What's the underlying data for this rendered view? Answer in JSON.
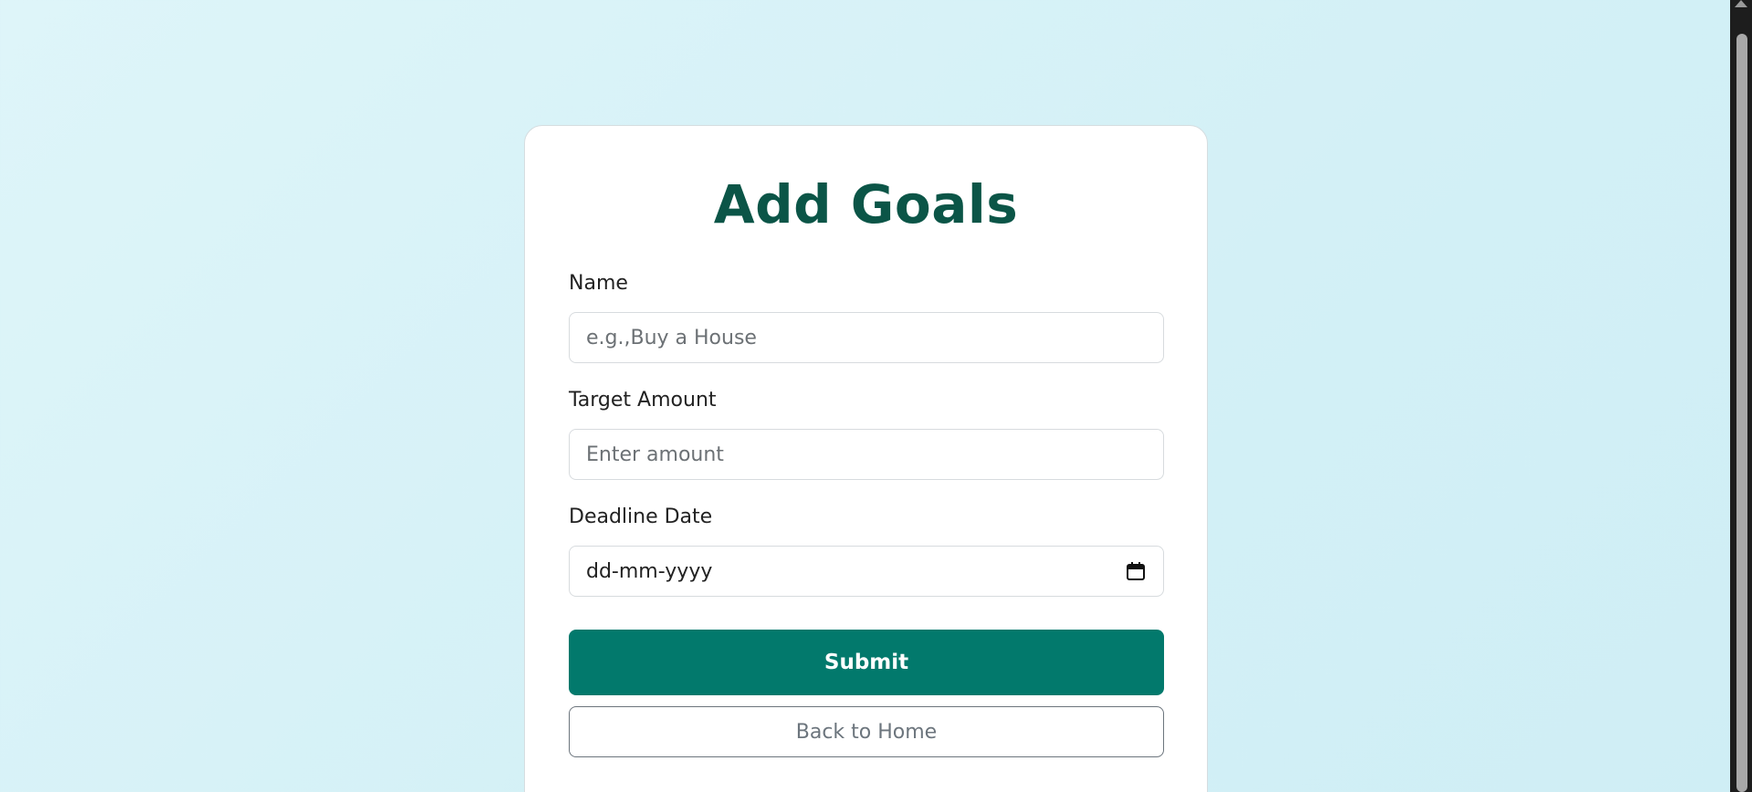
{
  "form": {
    "title": "Add Goals",
    "name_label": "Name",
    "name_placeholder": "e.g.,Buy a House",
    "amount_label": "Target Amount",
    "amount_placeholder": "Enter amount",
    "deadline_label": "Deadline Date",
    "deadline_placeholder": "dd-mm-yyyy",
    "submit_label": "Submit",
    "back_label": "Back to Home"
  },
  "icons": {
    "calendar": "calendar-icon"
  },
  "colors": {
    "primary": "#02796c",
    "title": "#0b5547",
    "secondary": "#6c757d"
  }
}
